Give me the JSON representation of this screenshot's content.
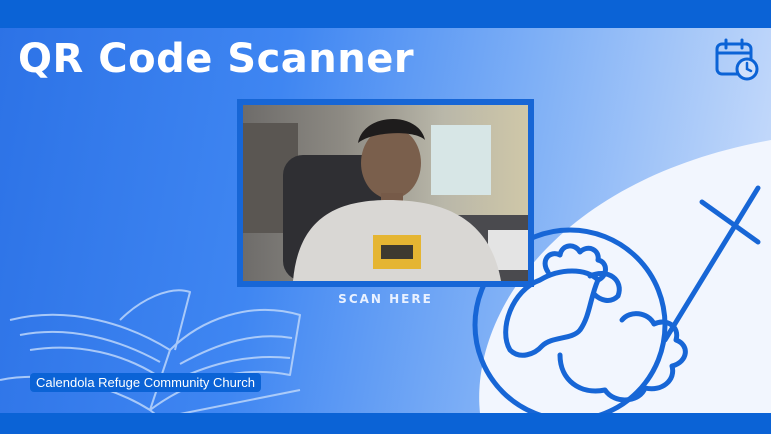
{
  "title": "QR Code Scanner",
  "scanner": {
    "label": "SCAN HERE"
  },
  "footer": {
    "church_name": "Calendola Refuge Community Church"
  },
  "icons": {
    "calendar": "calendar-clock-icon",
    "book": "open-bible-icon",
    "lamb": "lamb-icon",
    "cross": "cross-icon"
  },
  "colors": {
    "primary": "#0b63d6",
    "accent": "#1766d6"
  }
}
